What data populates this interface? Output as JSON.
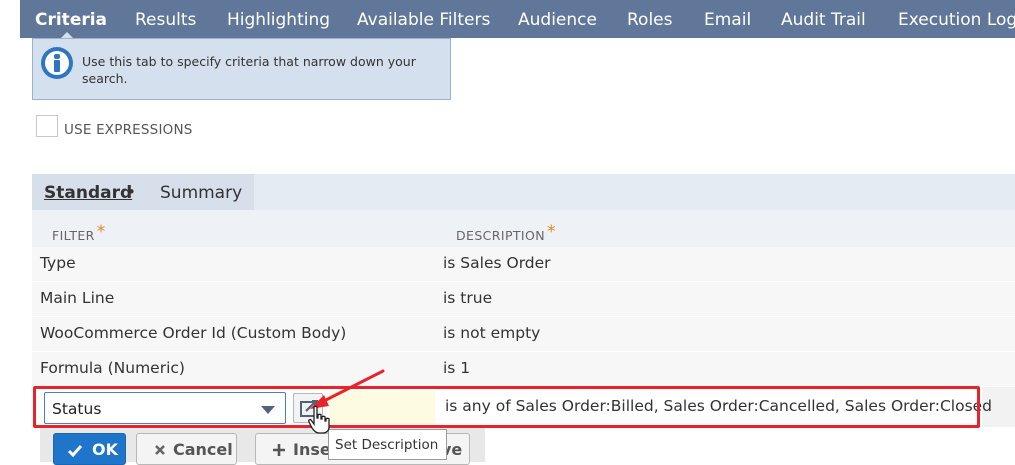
{
  "tabs": [
    {
      "label": "Criteria",
      "active": true
    },
    {
      "label": "Results"
    },
    {
      "label": "Highlighting"
    },
    {
      "label": "Available Filters"
    },
    {
      "label": "Audience"
    },
    {
      "label": "Roles"
    },
    {
      "label": "Email"
    },
    {
      "label": "Audit Trail"
    },
    {
      "label": "Execution Log"
    }
  ],
  "info": {
    "icon": "info-icon",
    "text": "Use this tab to specify criteria that narrow down your search."
  },
  "use_expressions": {
    "label": "USE EXPRESSIONS",
    "checked": false
  },
  "subtabs": {
    "standard": "Standard",
    "dot": "•",
    "summary": "Summary"
  },
  "table": {
    "headers": {
      "filter": "FILTER",
      "description": "DESCRIPTION",
      "required_mark": "*"
    },
    "rows": [
      {
        "filter": "Type",
        "description": "is Sales Order"
      },
      {
        "filter": "Main Line",
        "description": "is true"
      },
      {
        "filter": "WooCommerce Order Id (Custom Body)",
        "description": "is not empty"
      },
      {
        "filter": "Formula (Numeric)",
        "description": "is 1"
      }
    ]
  },
  "edit_row": {
    "filter_value": "Status",
    "description": "is any of Sales Order:Billed, Sales Order:Cancelled, Sales Order:Closed"
  },
  "buttons": {
    "ok": "OK",
    "cancel": "Cancel",
    "insert": "Inse",
    "remove_tail": "ve"
  },
  "tooltip": "Set Description",
  "colors": {
    "tab_bar": "#607799",
    "highlight": "#e8232a",
    "accent": "#1f75c9"
  }
}
